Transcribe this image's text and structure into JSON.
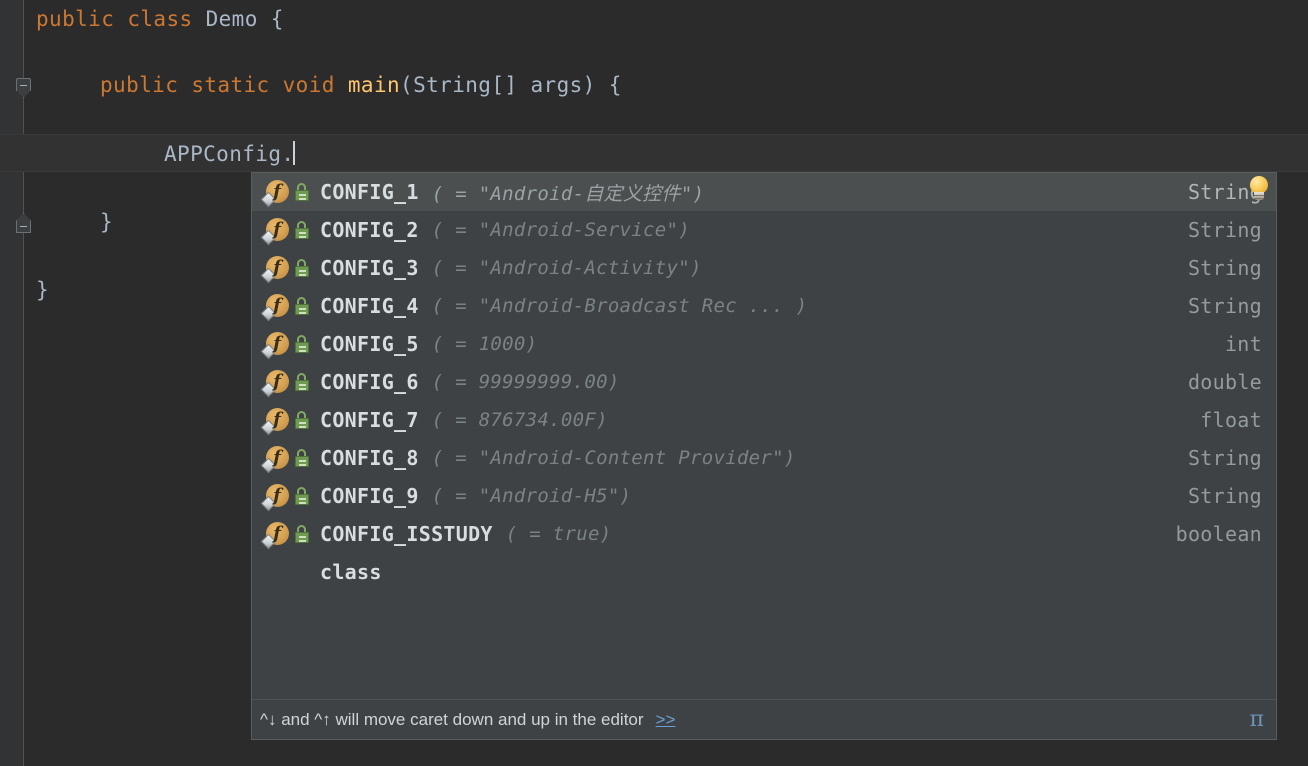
{
  "editor": {
    "lines": [
      {
        "indent": 0,
        "tokens": [
          {
            "t": "public",
            "c": "kw"
          },
          {
            "t": " ",
            "c": "pln"
          },
          {
            "t": "class",
            "c": "kw"
          },
          {
            "t": " Demo {",
            "c": "pln"
          }
        ]
      },
      {
        "indent": 1,
        "tokens": [
          {
            "t": "public",
            "c": "kw"
          },
          {
            "t": " ",
            "c": "pln"
          },
          {
            "t": "static",
            "c": "kw"
          },
          {
            "t": " ",
            "c": "pln"
          },
          {
            "t": "void",
            "c": "kw"
          },
          {
            "t": " ",
            "c": "pln"
          },
          {
            "t": "main",
            "c": "mth"
          },
          {
            "t": "(String[] args) {",
            "c": "pln"
          }
        ]
      },
      {
        "indent": 2,
        "tokens": [
          {
            "t": "APPConfig.",
            "c": "pln"
          }
        ]
      },
      {
        "indent": 1,
        "tokens": [
          {
            "t": "}",
            "c": "pln"
          }
        ]
      },
      {
        "indent": 0,
        "tokens": [
          {
            "t": "}",
            "c": "pln"
          }
        ]
      }
    ],
    "caret_text": "APPConfig.",
    "fold_markers": [
      "fold-expanded-down",
      "fold-expanded-up"
    ]
  },
  "popup": {
    "selected_index": 0,
    "items": [
      {
        "icon": "field-icon",
        "modifier_icon": "static-final-lock-icon",
        "name": "CONFIG_1",
        "tail": "( = \"Android-自定义控件\")",
        "type": "String"
      },
      {
        "icon": "field-icon",
        "modifier_icon": "static-final-lock-icon",
        "name": "CONFIG_2",
        "tail": "( = \"Android-Service\")",
        "type": "String"
      },
      {
        "icon": "field-icon",
        "modifier_icon": "static-final-lock-icon",
        "name": "CONFIG_3",
        "tail": "( = \"Android-Activity\")",
        "type": "String"
      },
      {
        "icon": "field-icon",
        "modifier_icon": "static-final-lock-icon",
        "name": "CONFIG_4",
        "tail": "( = \"Android-Broadcast Rec ... )",
        "type": "String"
      },
      {
        "icon": "field-icon",
        "modifier_icon": "static-final-lock-icon",
        "name": "CONFIG_5",
        "tail": "( = 1000)",
        "type": "int"
      },
      {
        "icon": "field-icon",
        "modifier_icon": "static-final-lock-icon",
        "name": "CONFIG_6",
        "tail": "( = 99999999.00)",
        "type": "double"
      },
      {
        "icon": "field-icon",
        "modifier_icon": "static-final-lock-icon",
        "name": "CONFIG_7",
        "tail": "( = 876734.00F)",
        "type": "float"
      },
      {
        "icon": "field-icon",
        "modifier_icon": "static-final-lock-icon",
        "name": "CONFIG_8",
        "tail": "( = \"Android-Content Provider\")",
        "type": "String"
      },
      {
        "icon": "field-icon",
        "modifier_icon": "static-final-lock-icon",
        "name": "CONFIG_9",
        "tail": "( = \"Android-H5\")",
        "type": "String"
      },
      {
        "icon": "field-icon",
        "modifier_icon": "static-final-lock-icon",
        "name": "CONFIG_ISSTUDY",
        "tail": "( = true)",
        "type": "boolean"
      },
      {
        "icon": "none",
        "modifier_icon": "none",
        "name": "class",
        "tail": "",
        "type": ""
      }
    ],
    "hint_icon": "lightbulb-icon",
    "footer": {
      "hint": "^↓ and ^↑ will move caret down and up in the editor",
      "more_link": ">>",
      "pi_symbol": "π"
    }
  },
  "colors": {
    "editor_bg": "#2b2b2b",
    "gutter_bg": "#313335",
    "popup_bg": "#3f4244",
    "selected_row": "#4b4f4f",
    "keyword": "#cc7832",
    "method": "#ffc66d",
    "plain_text": "#a9b7c6",
    "link": "#6a9fd8",
    "field_icon": "#d4a052",
    "lock_icon": "#6e9a52"
  }
}
